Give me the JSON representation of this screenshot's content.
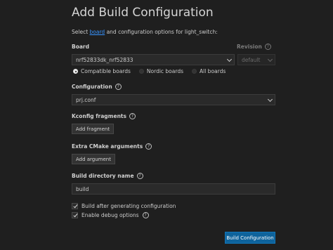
{
  "title": "Add Build Configuration",
  "subtitle": {
    "prefix": "Select ",
    "link": "board",
    "suffix": " and configuration options for light_switch:"
  },
  "board": {
    "label": "Board",
    "value": "nrf52833dk_nrf52833",
    "revision_label": "Revision",
    "revision_value": "default",
    "filters": [
      {
        "label": "Compatible boards",
        "selected": true
      },
      {
        "label": "Nordic boards",
        "selected": false
      },
      {
        "label": "All boards",
        "selected": false
      }
    ]
  },
  "configuration": {
    "label": "Configuration",
    "value": "prj.conf"
  },
  "kconfig": {
    "label": "Kconfig fragments",
    "button": "Add fragment"
  },
  "cmake": {
    "label": "Extra CMake arguments",
    "button": "Add argument"
  },
  "build_dir": {
    "label": "Build directory name",
    "value": "build"
  },
  "options": {
    "build_after": {
      "label": "Build after generating configuration",
      "checked": true
    },
    "debug": {
      "label": "Enable debug options",
      "checked": true
    }
  },
  "submit": "Build Configuration",
  "colors": {
    "background": "#1f1f1f",
    "link": "#3794ff",
    "primary_button": "#0e639c"
  },
  "icons": {
    "info": "info-circle-icon",
    "dropdown": "chevron-down-icon",
    "check": "checkmark-icon"
  }
}
